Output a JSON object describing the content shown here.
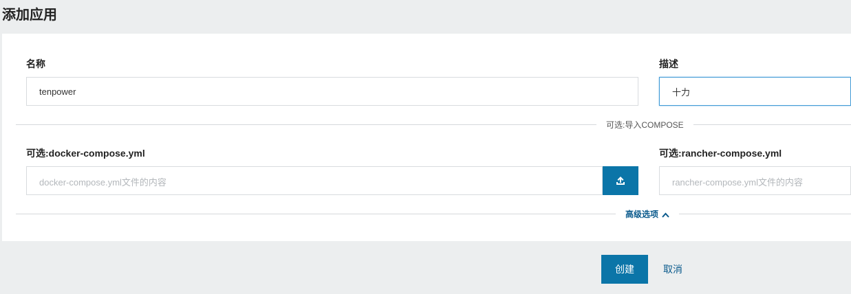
{
  "page": {
    "title": "添加应用"
  },
  "form": {
    "name": {
      "label": "名称",
      "value": "tenpower"
    },
    "description": {
      "label": "描述",
      "value": "十力"
    },
    "compose_divider": "可选:导入COMPOSE",
    "docker_compose": {
      "label": "可选:docker-compose.yml",
      "placeholder": "docker-compose.yml文件的内容",
      "upload_icon": "upload-icon"
    },
    "rancher_compose": {
      "label": "可选:rancher-compose.yml",
      "placeholder": "rancher-compose.yml文件的内容"
    },
    "advanced_toggle": {
      "label": "高级选项",
      "icon": "chevron-up-icon"
    }
  },
  "actions": {
    "create_label": "创建",
    "cancel_label": "取消"
  },
  "colors": {
    "primary": "#0b75a8",
    "link": "#0a5a8c",
    "focus_border": "#3f9ad6",
    "background": "#eceeef"
  }
}
